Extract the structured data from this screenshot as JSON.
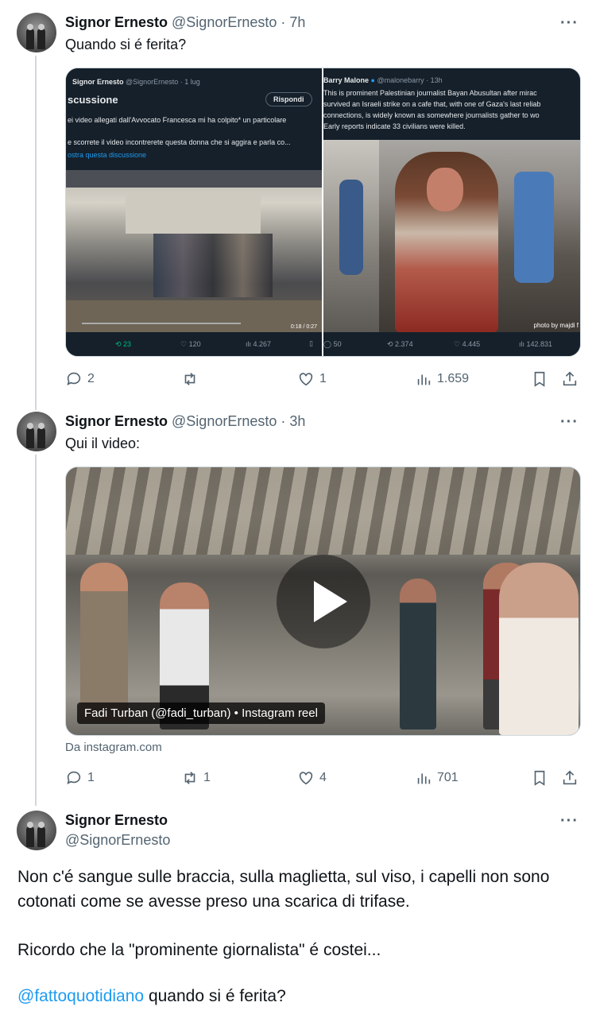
{
  "tweets": [
    {
      "name": "Signor Ernesto",
      "handle": "@SignorErnesto",
      "time": "· 7h",
      "text": "Quando si é ferita?",
      "embedded": {
        "left": {
          "author": "Signor Ernesto",
          "handle": "@SignorErnesto · 1 lug",
          "title": "scussione",
          "reply_button": "Rispondi",
          "line1": "ei video allegati dall'Avvocato Francesca mi ha colpito* un particolare",
          "line2": "e scorrete il video incontrerete questa donna che si aggira e parla co...",
          "link": "ostra questa discussione",
          "video_time": "0:18 / 0:27",
          "stats": {
            "retweets": "23",
            "likes": "120",
            "views": "4.267"
          }
        },
        "right": {
          "author": "Barry Malone",
          "handle": "@malonebarry · 13h",
          "line1": "This is prominent Palestinian journalist Bayan Abusultan after mirac",
          "line2": "survived an Israeli strike on a cafe that, with one of Gaza's last reliab",
          "line3": "connections, is widely known as somewhere journalists gather to wo",
          "line4": "Early reports indicate 33 civilians were killed.",
          "photo_credit": "photo by majdi f",
          "stats": {
            "replies": "50",
            "retweets": "2.374",
            "likes": "4.445",
            "views": "142.831"
          }
        }
      },
      "actions": {
        "replies": "2",
        "retweets": "",
        "likes": "1",
        "views": "1.659"
      }
    },
    {
      "name": "Signor Ernesto",
      "handle": "@SignorErnesto",
      "time": "· 3h",
      "text": "Qui il video:",
      "video_caption": "Fadi Turban (@fadi_turban) • Instagram reel",
      "source": "Da instagram.com",
      "actions": {
        "replies": "1",
        "retweets": "1",
        "likes": "4",
        "views": "701"
      }
    }
  ],
  "main": {
    "name": "Signor Ernesto",
    "handle": "@SignorErnesto",
    "lines": [
      "Non c'é sangue sulle braccia, sulla maglietta, sul viso, i capelli  non sono",
      "cotonati come se avesse preso una scarica di trifase.",
      "Ricordo che la \"prominente giornalista\" é costei...",
      "quando si é ferita?"
    ],
    "mention": "@fattoquotidiano"
  },
  "colors": {
    "accent": "#1d9bf0",
    "muted": "#536471",
    "retweet_green": "#00ba7c"
  }
}
